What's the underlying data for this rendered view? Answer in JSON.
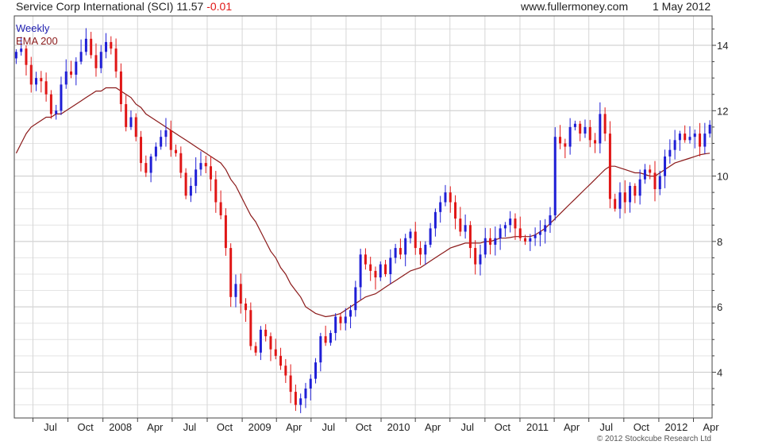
{
  "header": {
    "title": "Service Corp International (SCI)",
    "price": "11.57",
    "change": "-0.01",
    "website": "www.fullermoney.com",
    "date": "1 May 2012"
  },
  "legend": {
    "period": "Weekly",
    "ema": "EMA 200"
  },
  "copyright": "© 2012 Stockcube Research Ltd",
  "colors": {
    "up": "#1f1fd6",
    "down": "#e01616",
    "ema": "#8b1a1a",
    "grid": "#d6d6d6",
    "frame": "#444444",
    "change": "#e01616",
    "legend_period": "#1f1fb0"
  },
  "chart_data": {
    "type": "candlestick",
    "period": "weekly",
    "ylim": [
      2.6,
      14.9
    ],
    "y_ticks": [
      4,
      6,
      8,
      10,
      12,
      14
    ],
    "x_ticks": [
      "Jul",
      "Oct",
      "2008",
      "Apr",
      "Jul",
      "Oct",
      "2009",
      "Apr",
      "Jul",
      "Oct",
      "2010",
      "Apr",
      "Jul",
      "Oct",
      "2011",
      "Apr",
      "Jul",
      "Oct",
      "2012",
      "Apr"
    ],
    "x_tick_dates": [
      "2007-07-01",
      "2007-10-01",
      "2008-01-01",
      "2008-04-01",
      "2008-07-01",
      "2008-10-01",
      "2009-01-01",
      "2009-04-01",
      "2009-07-01",
      "2009-10-01",
      "2010-01-01",
      "2010-04-01",
      "2010-07-01",
      "2010-10-01",
      "2011-01-01",
      "2011-04-01",
      "2011-07-01",
      "2011-10-01",
      "2012-01-01",
      "2012-04-01"
    ],
    "xlim": [
      "2007-05-13",
      "2012-05-20"
    ],
    "start_date": "2007-05-18",
    "close": [
      13.8,
      13.9,
      13.4,
      12.8,
      13.0,
      12.9,
      12.5,
      11.9,
      12.0,
      12.8,
      13.2,
      13.1,
      13.5,
      13.8,
      14.2,
      13.7,
      13.3,
      13.8,
      14.1,
      13.9,
      13.2,
      12.2,
      11.5,
      11.8,
      11.2,
      10.4,
      10.1,
      10.6,
      10.9,
      11.2,
      11.4,
      10.8,
      10.7,
      10.1,
      9.4,
      9.7,
      10.2,
      10.4,
      10.3,
      9.9,
      9.2,
      8.8,
      7.8,
      6.3,
      6.7,
      6.1,
      5.9,
      4.8,
      4.6,
      5.3,
      5.1,
      4.7,
      4.5,
      4.2,
      3.9,
      3.4,
      3.0,
      3.2,
      3.5,
      3.8,
      4.3,
      5.1,
      4.9,
      5.2,
      5.7,
      5.5,
      5.7,
      5.9,
      6.6,
      7.6,
      7.3,
      7.1,
      6.9,
      7.3,
      7.0,
      7.5,
      7.8,
      7.6,
      8.1,
      8.3,
      7.8,
      7.6,
      7.9,
      8.4,
      8.9,
      9.2,
      9.5,
      9.2,
      8.7,
      8.3,
      8.5,
      7.8,
      7.3,
      7.6,
      8.1,
      7.9,
      8.1,
      8.4,
      8.5,
      8.7,
      8.4,
      8.1,
      8.0,
      8.1,
      8.2,
      8.3,
      8.5,
      8.8,
      11.2,
      11.0,
      10.9,
      11.5,
      11.6,
      11.3,
      11.5,
      11.1,
      11.0,
      11.9,
      11.3,
      9.3,
      9.0,
      9.5,
      9.2,
      9.7,
      9.4,
      9.9,
      10.2,
      10.1,
      9.6,
      10.0,
      10.6,
      10.8,
      11.1,
      11.3,
      11.1,
      11.2,
      11.3,
      10.9,
      11.3,
      11.57
    ],
    "ema_200": [
      10.7,
      11.0,
      11.3,
      11.5,
      11.6,
      11.7,
      11.8,
      11.8,
      11.9,
      11.9,
      12.0,
      12.1,
      12.2,
      12.3,
      12.4,
      12.5,
      12.6,
      12.6,
      12.7,
      12.7,
      12.7,
      12.6,
      12.5,
      12.4,
      12.2,
      12.1,
      11.9,
      11.8,
      11.7,
      11.6,
      11.5,
      11.4,
      11.3,
      11.2,
      11.1,
      11.0,
      10.9,
      10.8,
      10.7,
      10.6,
      10.5,
      10.4,
      10.2,
      9.9,
      9.7,
      9.4,
      9.1,
      8.8,
      8.6,
      8.3,
      8.0,
      7.7,
      7.5,
      7.2,
      7.0,
      6.7,
      6.5,
      6.3,
      6.0,
      5.9,
      5.8,
      5.75,
      5.7,
      5.72,
      5.75,
      5.8,
      5.9,
      6.0,
      6.1,
      6.2,
      6.3,
      6.35,
      6.4,
      6.5,
      6.6,
      6.7,
      6.8,
      6.9,
      7.0,
      7.1,
      7.15,
      7.2,
      7.3,
      7.4,
      7.5,
      7.6,
      7.7,
      7.8,
      7.85,
      7.9,
      7.95,
      7.95,
      7.95,
      7.95,
      8.0,
      8.0,
      8.05,
      8.1,
      8.1,
      8.12,
      8.15,
      8.15,
      8.15,
      8.15,
      8.2,
      8.3,
      8.4,
      8.55,
      8.7,
      8.85,
      9.0,
      9.15,
      9.3,
      9.45,
      9.6,
      9.75,
      9.9,
      10.05,
      10.2,
      10.3,
      10.3,
      10.25,
      10.2,
      10.15,
      10.1,
      10.1,
      10.05,
      10.0,
      10.0,
      10.1,
      10.2,
      10.3,
      10.4,
      10.45,
      10.5,
      10.55,
      10.6,
      10.65,
      10.68,
      10.7
    ]
  }
}
